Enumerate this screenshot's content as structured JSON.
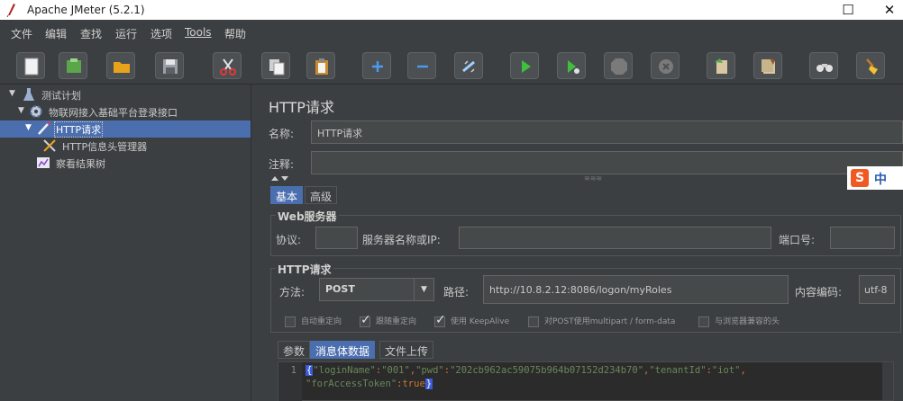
{
  "window": {
    "title": "Apache JMeter (5.2.1)",
    "maximize": "☐",
    "close": "✕"
  },
  "menu": [
    "文件",
    "编辑",
    "查找",
    "运行",
    "选项",
    "Tools",
    "帮助"
  ],
  "toolbar": {
    "buttons": [
      "new-icon",
      "templates-icon",
      "open-icon",
      "save-icon",
      "cut-icon",
      "copy-icon",
      "paste-icon",
      "expand-icon",
      "collapse-icon",
      "toggle-icon",
      "start-icon",
      "start-no-pause-icon",
      "stop-icon",
      "shutdown-icon",
      "clear-icon",
      "clear-all-icon",
      "search-icon",
      "reset-search-icon"
    ]
  },
  "tree": {
    "items": [
      {
        "label": "测试计划",
        "icon": "test-plan-icon"
      },
      {
        "label": "物联网接入基础平台登录接口",
        "icon": "thread-group-gear-icon"
      },
      {
        "label": "HTTP请求",
        "icon": "http-sampler-pen-icon",
        "selected": true
      },
      {
        "label": "HTTP信息头管理器",
        "icon": "tools-icon"
      },
      {
        "label": "察看结果树",
        "icon": "result-tree-icon"
      }
    ]
  },
  "panel": {
    "title": "HTTP请求",
    "name_label": "名称:",
    "name_value": "HTTP请求",
    "comment_label": "注释:",
    "comment_value": "",
    "tabs": [
      "基本",
      "高级"
    ],
    "web_server": {
      "group_title": "Web服务器",
      "protocol_label": "协议:",
      "protocol_value": "",
      "server_label": "服务器名称或IP:",
      "server_value": "",
      "port_label": "端口号:",
      "port_value": ""
    },
    "http_request": {
      "group_title": "HTTP请求",
      "method_label": "方法:",
      "method_value": "POST",
      "path_label": "路径:",
      "path_value": "http://10.8.2.12:8086/logon/myRoles",
      "encoding_label": "内容编码:",
      "encoding_value": "utf-8"
    },
    "options": [
      {
        "label": "自动重定向",
        "checked": false
      },
      {
        "label": "跟随重定向",
        "checked": true
      },
      {
        "label": "使用 KeepAlive",
        "checked": true
      },
      {
        "label": "对POST使用multipart / form-data",
        "checked": false
      },
      {
        "label": "与浏览器兼容的头",
        "checked": false
      }
    ],
    "body_tabs": [
      "参数",
      "消息体数据",
      "文件上传"
    ],
    "body": {
      "line_number": "1",
      "open_brace": "{",
      "key1": "\"loginName\"",
      "val1": "\"001\"",
      "key2": "\"pwd\"",
      "val2": "\"202cb962ac59075b964b07152d234b70\"",
      "key3": "\"tenantId\"",
      "val3": "\"iot\"",
      "key4": "\"forAccessToken\"",
      "val4": "true",
      "close_brace": "}",
      "colon": ":",
      "comma": ","
    }
  },
  "ime": {
    "s": "S",
    "zh": "中"
  }
}
